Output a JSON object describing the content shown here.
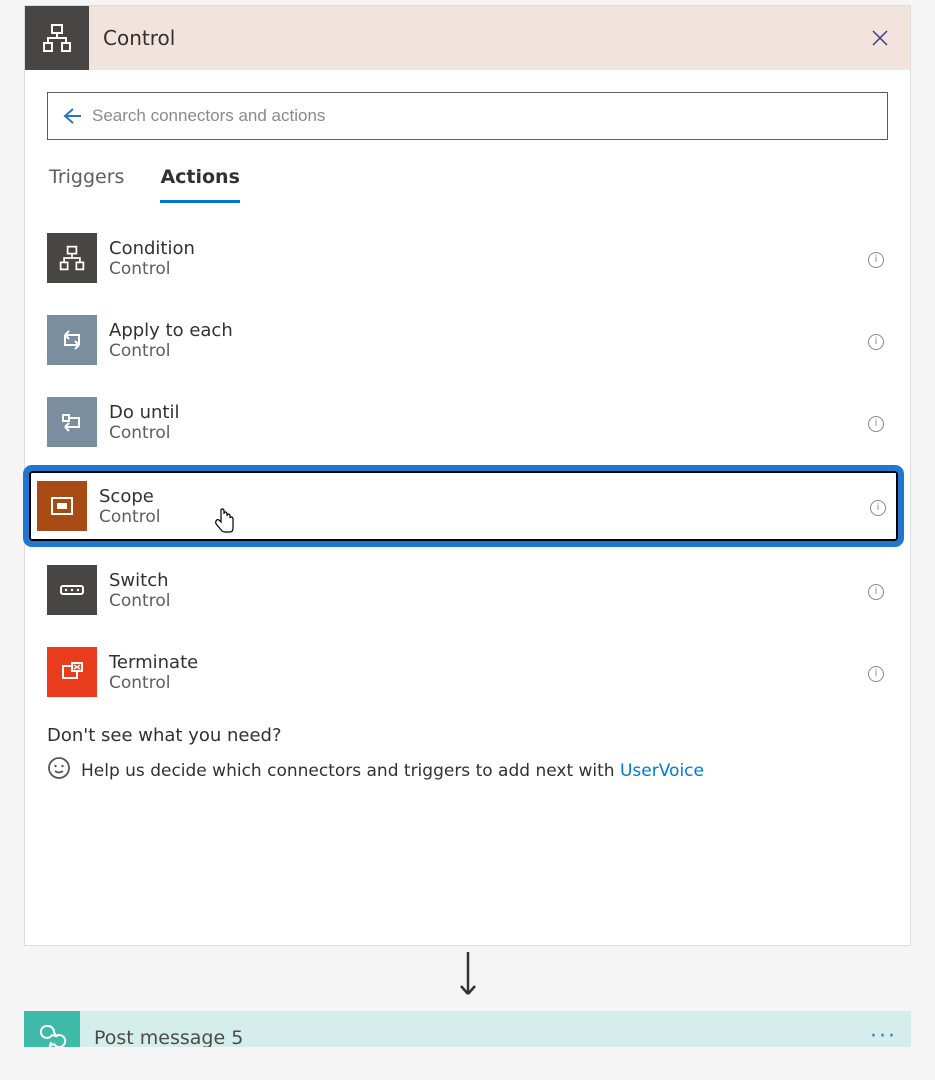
{
  "header": {
    "title": "Control"
  },
  "search": {
    "placeholder": "Search connectors and actions"
  },
  "tabs": {
    "triggers": "Triggers",
    "actions": "Actions"
  },
  "actions": [
    {
      "title": "Condition",
      "sub": "Control"
    },
    {
      "title": "Apply to each",
      "sub": "Control"
    },
    {
      "title": "Do until",
      "sub": "Control"
    },
    {
      "title": "Scope",
      "sub": "Control"
    },
    {
      "title": "Switch",
      "sub": "Control"
    },
    {
      "title": "Terminate",
      "sub": "Control"
    }
  ],
  "help": {
    "title": "Don't see what you need?",
    "text": "Help us decide which connectors and triggers to add next with ",
    "link": "UserVoice"
  },
  "next": {
    "title": "Post message 5"
  }
}
